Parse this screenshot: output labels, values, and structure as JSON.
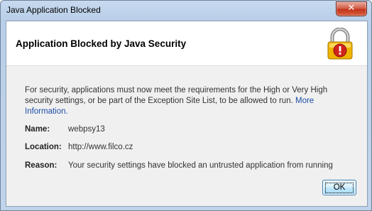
{
  "window": {
    "title": "Java Application Blocked",
    "close_icon": "close-icon"
  },
  "header": {
    "title": "Application Blocked by Java Security",
    "icon": "lock-warning-icon"
  },
  "message": {
    "text": "For security, applications must now meet the requirements for the High or Very High security settings, or be part of the Exception Site List, to be allowed to run.",
    "link": "More Information."
  },
  "details": [
    {
      "label": "Name:",
      "value": "webpsy13"
    },
    {
      "label": "Location:",
      "value": "http://www.filco.cz"
    },
    {
      "label": "Reason:",
      "value": "Your security settings have blocked an untrusted application from running"
    }
  ],
  "buttons": {
    "ok": "OK"
  },
  "colors": {
    "titlebar": "#c6d9ef",
    "close_button": "#c2331b",
    "link": "#1f4fa8",
    "lock_body": "#f0b400",
    "warning_badge": "#d0231b"
  }
}
